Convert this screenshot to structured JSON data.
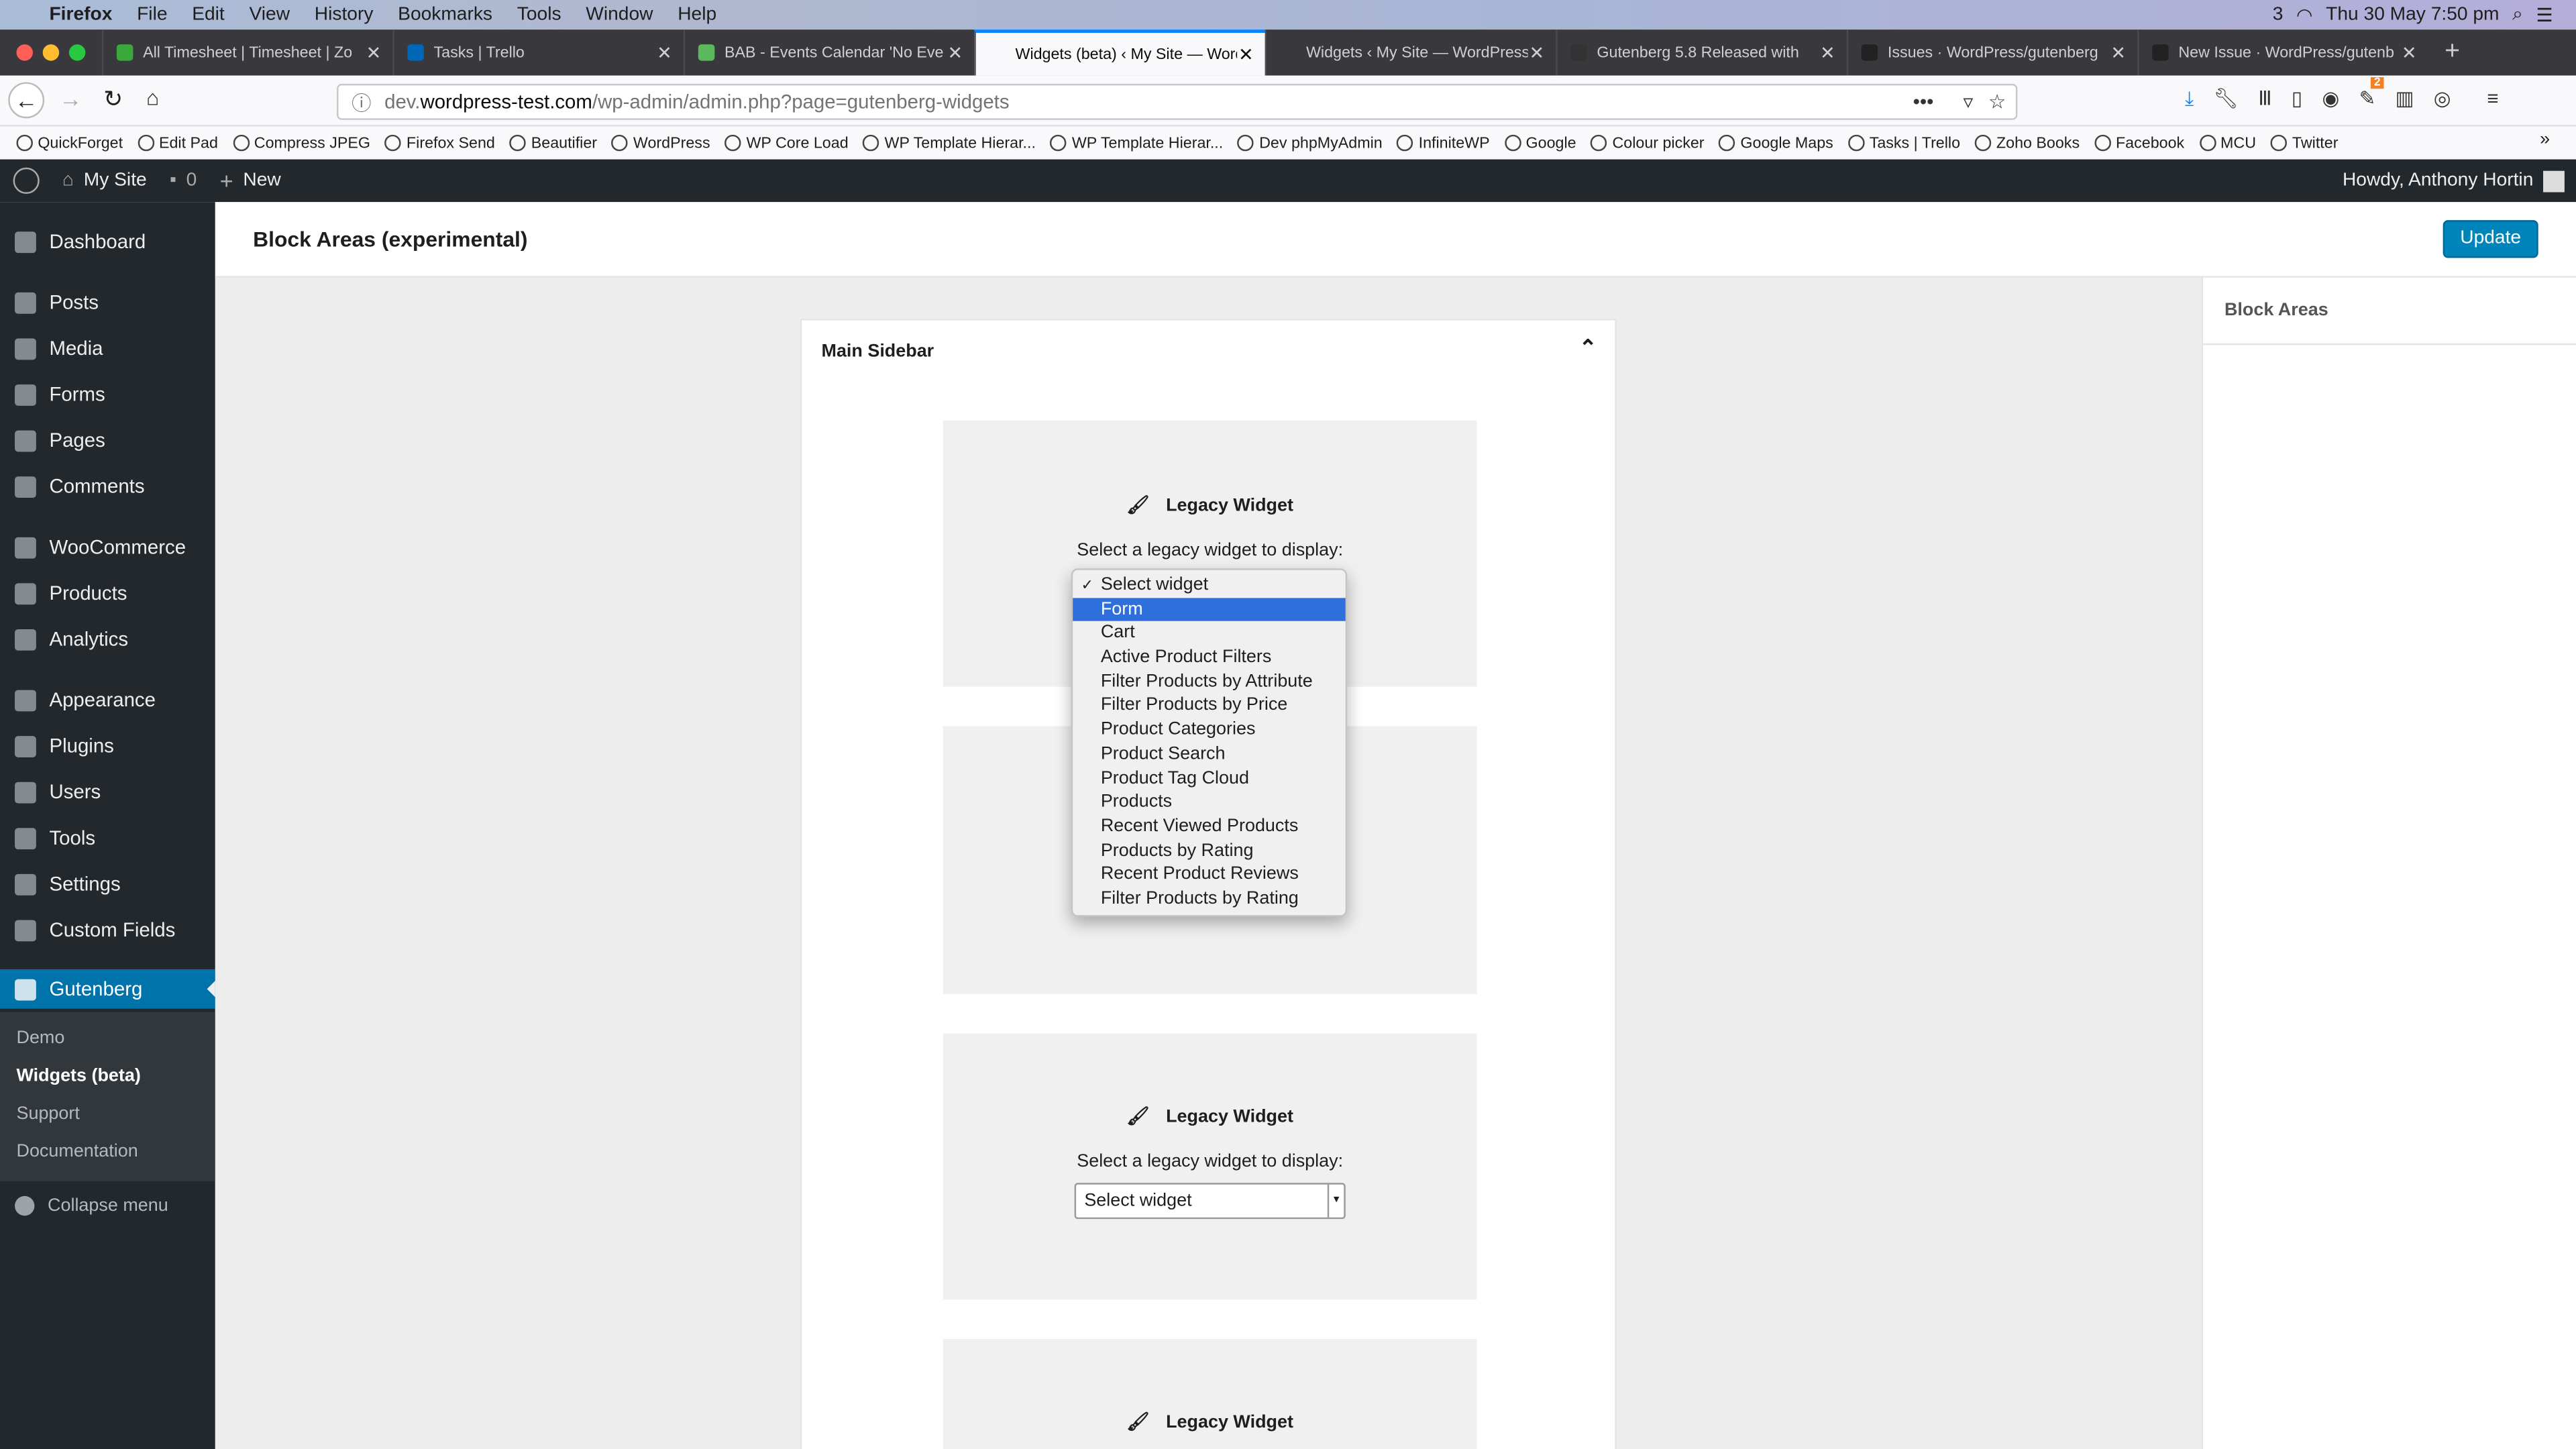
{
  "macos": {
    "app": "Firefox",
    "menus": [
      "File",
      "Edit",
      "View",
      "History",
      "Bookmarks",
      "Tools",
      "Window",
      "Help"
    ],
    "badge": "3",
    "clock": "Thu 30 May  7:50 pm"
  },
  "tabs": [
    {
      "title": "All Timesheet | Timesheet | Zo",
      "color": "#3aa83a"
    },
    {
      "title": "Tasks | Trello",
      "color": "#0067b8"
    },
    {
      "title": "BAB - Events Calendar 'No Eve",
      "color": "#5cb85c"
    },
    {
      "title": "Widgets (beta) ‹ My Site — WordP",
      "color": "",
      "active": true
    },
    {
      "title": "Widgets ‹ My Site — WordPress",
      "color": ""
    },
    {
      "title": "Gutenberg 5.8 Released with",
      "color": "#333"
    },
    {
      "title": "Issues · WordPress/gutenberg",
      "color": "#222"
    },
    {
      "title": "New Issue · WordPress/gutenb",
      "color": "#222"
    }
  ],
  "url": {
    "prefix": "dev.",
    "domain": "wordpress-test.com",
    "path": "/wp-admin/admin.php?page=gutenberg-widgets"
  },
  "toolbar_badge": "2",
  "bookmarks": [
    "QuickForget",
    "Edit Pad",
    "Compress JPEG",
    "Firefox Send",
    "Beautifier",
    "WordPress",
    "WP Core Load",
    "WP Template Hierar...",
    "WP Template Hierar...",
    "Dev phpMyAdmin",
    "InfiniteWP",
    "Google",
    "Colour picker",
    "Google Maps",
    "Tasks | Trello",
    "Zoho Books",
    "Facebook",
    "MCU",
    "Twitter"
  ],
  "adminbar": {
    "site": "My Site",
    "comments": "0",
    "new": "New",
    "howdy": "Howdy, Anthony Hortin"
  },
  "sidebar": {
    "items": [
      "Dashboard",
      "Posts",
      "Media",
      "Forms",
      "Pages",
      "Comments",
      "WooCommerce",
      "Products",
      "Analytics",
      "Appearance",
      "Plugins",
      "Users",
      "Tools",
      "Settings",
      "Custom Fields",
      "Gutenberg"
    ],
    "submenu": [
      "Demo",
      "Widgets (beta)",
      "Support",
      "Documentation"
    ],
    "collapse": "Collapse menu"
  },
  "header": {
    "title": "Block Areas (experimental)",
    "update": "Update"
  },
  "right_sidebar": {
    "title": "Block Areas"
  },
  "panel": {
    "title": "Main Sidebar"
  },
  "widget": {
    "title": "Legacy Widget",
    "label": "Select a legacy widget to display:",
    "select_value": "Select widget"
  },
  "dropdown": {
    "selected": "Select widget",
    "highlighted": "Form",
    "options": [
      "Select widget",
      "Form",
      "Cart",
      "Active Product Filters",
      "Filter Products by Attribute",
      "Filter Products by Price",
      "Product Categories",
      "Product Search",
      "Product Tag Cloud",
      "Products",
      "Recent Viewed Products",
      "Products by Rating",
      "Recent Product Reviews",
      "Filter Products by Rating"
    ]
  },
  "colors": {
    "wp_blue": "#0073aa",
    "admin_dark": "#23282d",
    "highlight": "#2f6fdb"
  }
}
